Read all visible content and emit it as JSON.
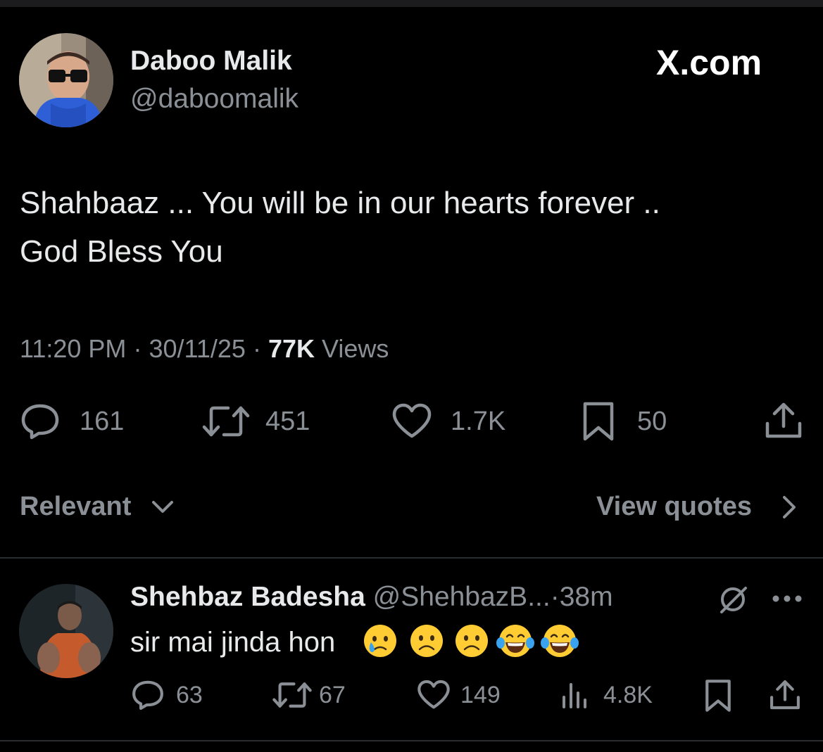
{
  "brand": {
    "label": "X.com"
  },
  "tweet": {
    "author_name": "Daboo Malik",
    "author_handle": "@daboomalik",
    "text_line1": "Shahbaaz ... You will be in our hearts forever ..",
    "text_line2": "God Bless You",
    "time": "11:20 PM",
    "dot": "·",
    "date": "30/11/25",
    "views_count": "77K",
    "views_label": "Views",
    "actions": {
      "replies": "161",
      "reposts": "451",
      "likes": "1.7K",
      "bookmarks": "50"
    }
  },
  "sort": {
    "label": "Relevant"
  },
  "quotes": {
    "label": "View quotes"
  },
  "reply": {
    "author_name": "Shehbaz Badesha",
    "author_handle": "@ShehbazB...",
    "age": "38m",
    "dot": "·",
    "text": "sir mai jinda hon",
    "emojis": [
      "crying-face",
      "frowning-face",
      "frowning-face",
      "tears-of-joy",
      "tears-of-joy"
    ],
    "actions": {
      "replies": "63",
      "reposts": "67",
      "likes": "149",
      "views": "4.8K"
    }
  },
  "colors": {
    "background": "#000000",
    "text": "#e7e9ea",
    "muted": "#8b9096",
    "separator": "#2a2d30"
  }
}
